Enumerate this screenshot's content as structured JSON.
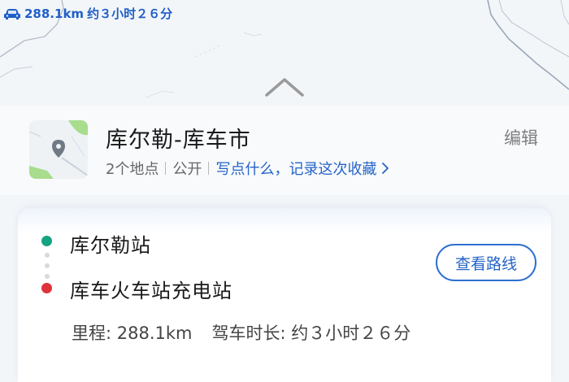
{
  "route_summary": {
    "distance": "288.1km",
    "duration": "约３小时２６分",
    "icon": "car-icon"
  },
  "handle": {
    "icon": "chevron-up-icon"
  },
  "collection": {
    "title": "库尔勒-库车市",
    "edit_label": "编辑",
    "place_count": "2个地点",
    "visibility": "公开",
    "write_prompt": "写点什么，记录这次收藏",
    "thumbnail_icon": "map-pin-icon"
  },
  "route": {
    "start": {
      "name": "库尔勒站",
      "color": "#14a37f"
    },
    "end": {
      "name": "库车火车站充电站",
      "color": "#e0323a"
    },
    "view_route_label": "查看路线",
    "distance_label": "里程: 288.1km",
    "duration_label": "驾车时长: 约３小时２６分"
  },
  "colors": {
    "accent": "#2563c7",
    "map_road": "#a9b6c6"
  }
}
